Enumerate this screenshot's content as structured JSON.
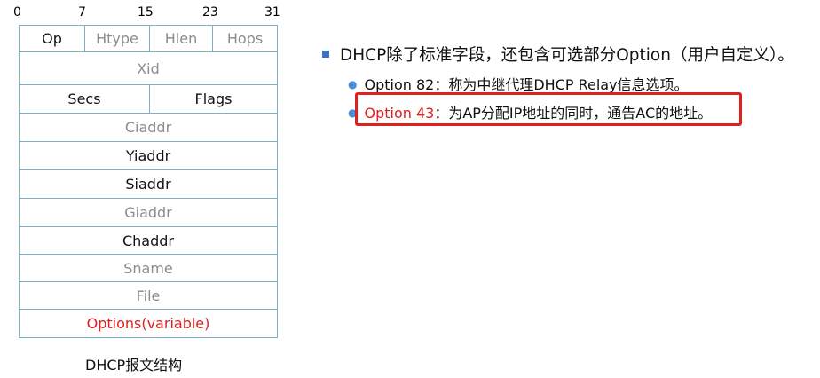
{
  "bit_positions": [
    "0",
    "7",
    "15",
    "23",
    "31"
  ],
  "packet": {
    "row1": [
      "Op",
      "Htype",
      "Hlen",
      "Hops"
    ],
    "xid": "Xid",
    "secs": "Secs",
    "flags": "Flags",
    "ciaddr": "Ciaddr",
    "yiaddr": "Yiaddr",
    "siaddr": "Siaddr",
    "giaddr": "Giaddr",
    "chaddr": "Chaddr",
    "sname": "Sname",
    "file": "File",
    "options": "Options(variable)"
  },
  "caption": "DHCP报文结构",
  "bullet": {
    "main": "DHCP除了标准字段，还包含可选部分Option（用户自定义）。",
    "sub1": "Option 82：称为中继代理DHCP Relay信息选项。",
    "sub2_label": "Option 43",
    "sub2_text": "：为AP分配IP地址的同时，通告AC的地址。"
  },
  "colors": {
    "border": "#7fb2c8",
    "highlight": "#e0201e",
    "bullet_square": "#3a74c4",
    "gray_text": "#8c8c8c"
  }
}
